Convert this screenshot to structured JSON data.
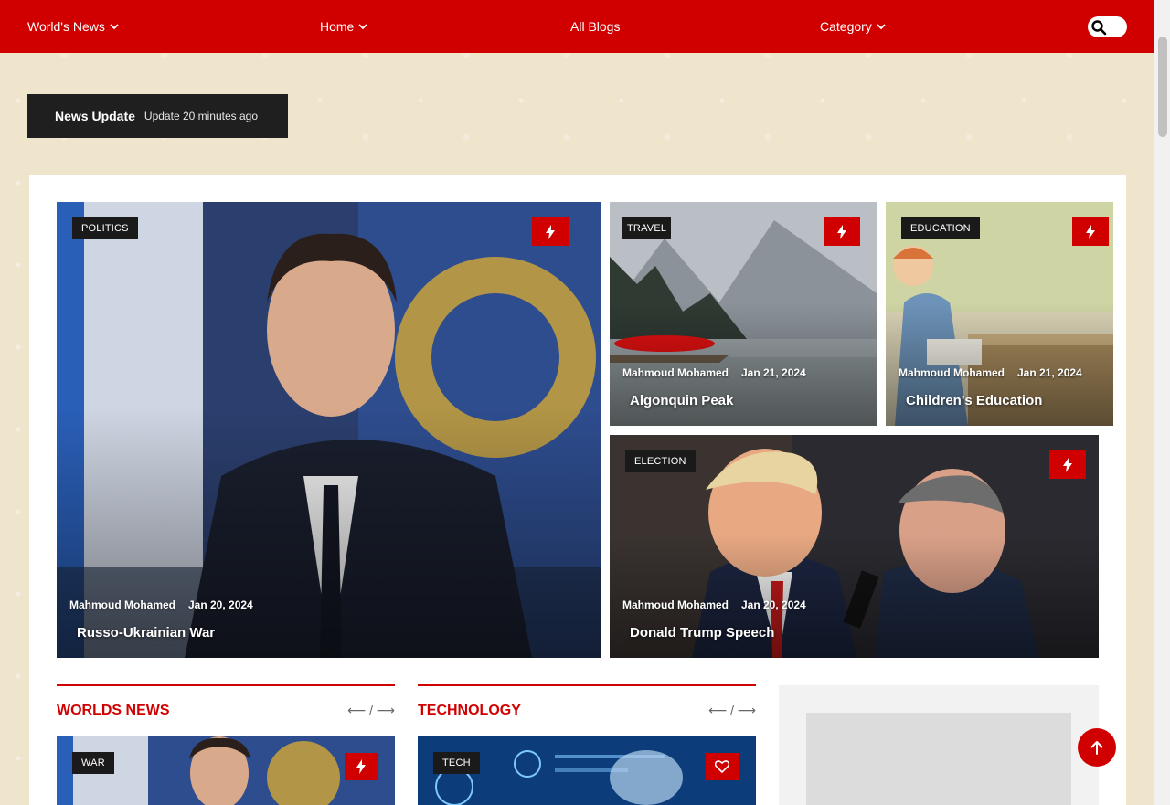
{
  "navbar": {
    "items": [
      {
        "label": "World's News",
        "has_dropdown": true
      },
      {
        "label": "Home",
        "has_dropdown": true
      },
      {
        "label": "All Blogs",
        "has_dropdown": false
      },
      {
        "label": "Category",
        "has_dropdown": true
      }
    ],
    "search_icon": "search-icon"
  },
  "news_update": {
    "label": "News Update",
    "time": "Update 20 minutes ago"
  },
  "featured": {
    "main": {
      "category": "POLITICS",
      "author": "Mahmoud Mohamed",
      "date": "Jan 20, 2024",
      "title": "Russo-Ukrainian War",
      "icon": "bolt-icon"
    },
    "travel": {
      "category": "TRAVEL",
      "author": "Mahmoud Mohamed",
      "date": "Jan 21, 2024",
      "title": "Algonquin Peak",
      "icon": "bolt-icon"
    },
    "education": {
      "category": "EDUCATION",
      "author": "Mahmoud Mohamed",
      "date": "Jan 21, 2024",
      "title": "Children's Education",
      "icon": "bolt-icon"
    },
    "election": {
      "category": "ELECTION",
      "author": "Mahmoud Mohamed",
      "date": "Jan 20, 2024",
      "title": "Donald Trump Speech",
      "icon": "bolt-icon"
    }
  },
  "sections": {
    "worlds_news": {
      "title": "WORLDS NEWS",
      "nav": "⟵ / ⟶",
      "post_category": "WAR",
      "icon": "bolt-icon"
    },
    "technology": {
      "title": "TECHNOLOGY",
      "nav": "⟵ / ⟶",
      "post_category": "TECH",
      "icon": "heart-icon"
    }
  },
  "colors": {
    "accent": "#d10000",
    "dark": "#1f1f1f",
    "background": "#efe4cc"
  }
}
